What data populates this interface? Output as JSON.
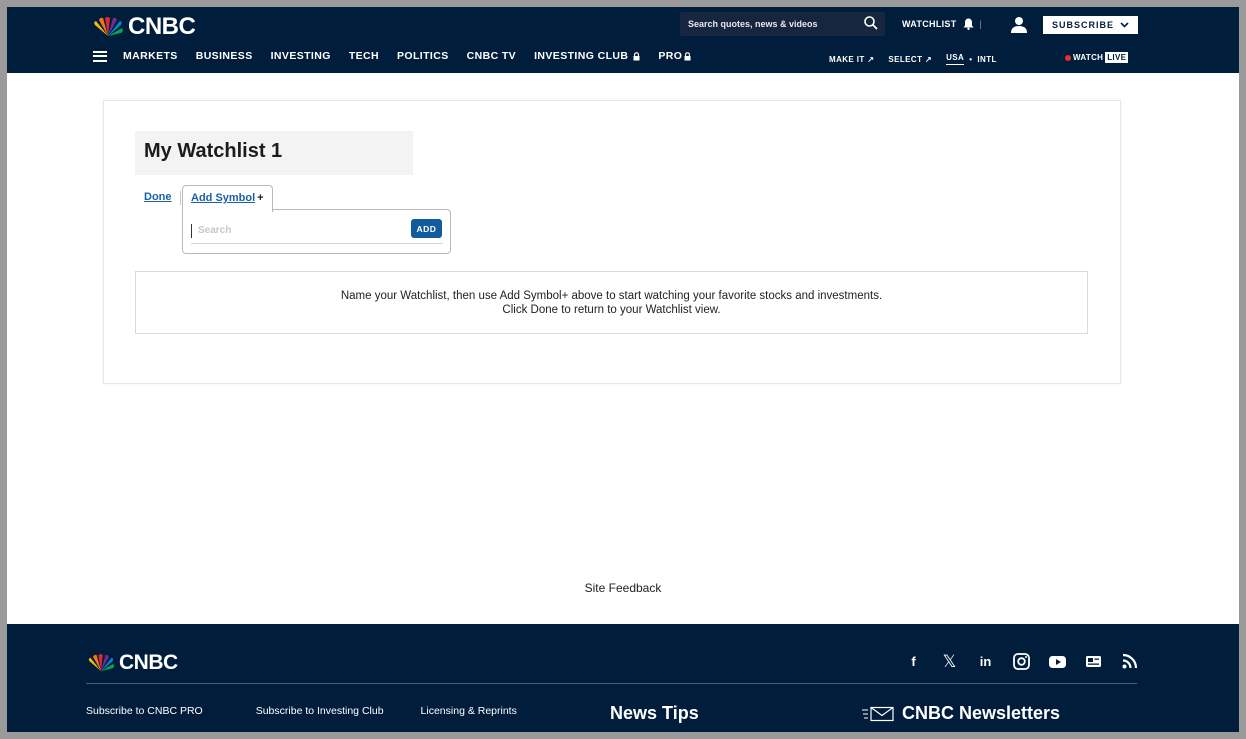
{
  "header": {
    "logo_text": "CNBC",
    "search_placeholder": "Search quotes, news & videos",
    "watchlist_label": "WATCHLIST",
    "subscribe_label": "SUBSCRIBE",
    "nav_items": [
      "MARKETS",
      "BUSINESS",
      "INVESTING",
      "TECH",
      "POLITICS",
      "CNBC TV",
      "INVESTING CLUB",
      "PRO"
    ],
    "subnav": {
      "make_it": "MAKE IT",
      "select": "SELECT",
      "usa": "USA",
      "dash": "•",
      "intl": "INTL"
    },
    "watch_label": "WATCH",
    "live_label": "LIVE"
  },
  "watchlist": {
    "title": "My Watchlist 1",
    "done_label": "Done",
    "add_symbol_label": "Add Symbol",
    "add_symbol_plus": "+",
    "search_placeholder": "Search",
    "add_button_label": "ADD",
    "info_line1": "Name your Watchlist, then use Add Symbol+ above to start watching your favorite stocks and investments.",
    "info_line2": "Click Done to return to your Watchlist view."
  },
  "site_feedback": "Site Feedback",
  "footer": {
    "logo_text": "CNBC",
    "social_icons": [
      "facebook-icon",
      "x-icon",
      "linkedin-icon",
      "instagram-icon",
      "youtube-icon",
      "news-icon",
      "rss-icon"
    ],
    "links": [
      "Subscribe to CNBC PRO",
      "Subscribe to Investing Club",
      "Licensing & Reprints"
    ],
    "news_tips": "News Tips",
    "newsletters": "CNBC Newsletters"
  },
  "colors": {
    "navy": "#001e3c",
    "link_blue": "#1a5fa8",
    "add_button": "#105c9c",
    "live_red": "#e0303b"
  }
}
